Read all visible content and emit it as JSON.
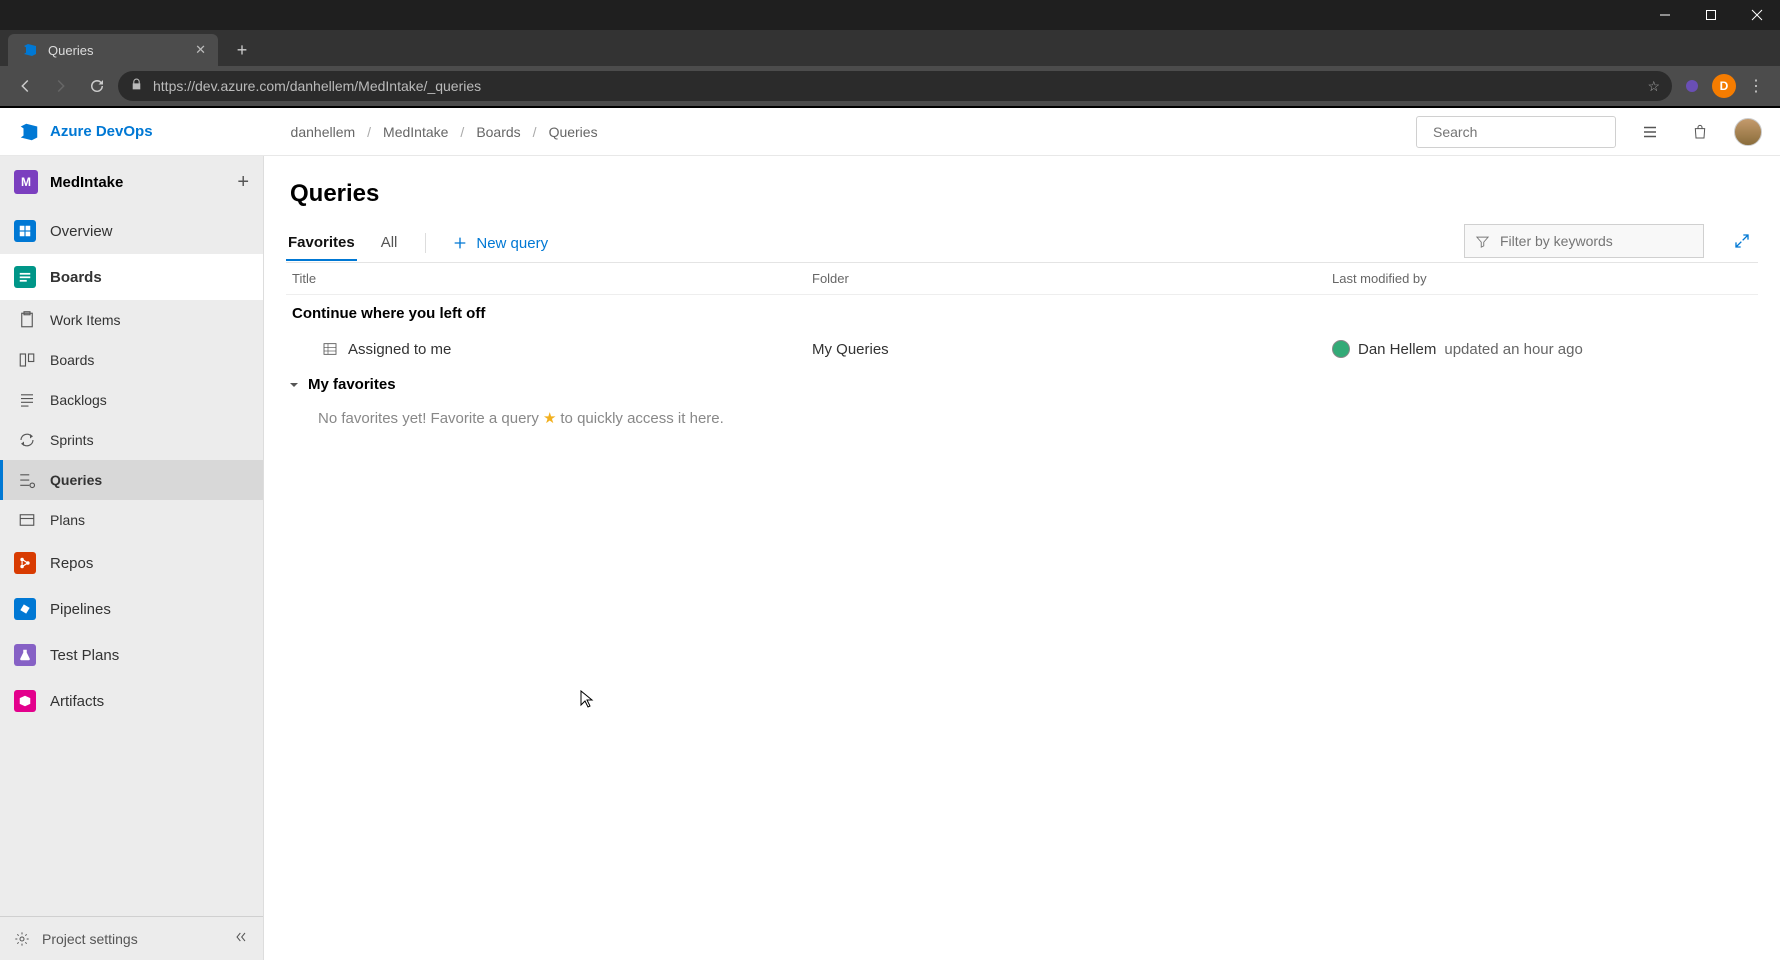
{
  "browser": {
    "tab_title": "Queries",
    "url": "https://dev.azure.com/danhellem/MedIntake/_queries",
    "avatar_letter": "D"
  },
  "header": {
    "brand": "Azure DevOps",
    "breadcrumbs": [
      "danhellem",
      "MedIntake",
      "Boards",
      "Queries"
    ],
    "search_placeholder": "Search"
  },
  "sidebar": {
    "project_letter": "M",
    "project_name": "MedIntake",
    "items": [
      {
        "label": "Overview",
        "color": "#0078d4"
      },
      {
        "label": "Boards",
        "color": "#009688",
        "active": true,
        "children": [
          {
            "label": "Work Items"
          },
          {
            "label": "Boards"
          },
          {
            "label": "Backlogs"
          },
          {
            "label": "Sprints"
          },
          {
            "label": "Queries",
            "selected": true
          },
          {
            "label": "Plans"
          }
        ]
      },
      {
        "label": "Repos",
        "color": "#d83b01"
      },
      {
        "label": "Pipelines",
        "color": "#0078d4"
      },
      {
        "label": "Test Plans",
        "color": "#8661c5"
      },
      {
        "label": "Artifacts",
        "color": "#e3008c"
      }
    ],
    "settings_label": "Project settings"
  },
  "content": {
    "title": "Queries",
    "tabs": {
      "favorites": "Favorites",
      "all": "All"
    },
    "new_query": "New query",
    "filter_placeholder": "Filter by keywords",
    "columns": {
      "title": "Title",
      "folder": "Folder",
      "modified": "Last modified by"
    },
    "continue_label": "Continue where you left off",
    "query_row": {
      "title": "Assigned to me",
      "folder": "My Queries",
      "user": "Dan Hellem",
      "time": "updated an hour ago"
    },
    "favorites_group": "My favorites",
    "empty_pre": "No favorites yet! Favorite a query",
    "empty_post": "to quickly access it here."
  }
}
